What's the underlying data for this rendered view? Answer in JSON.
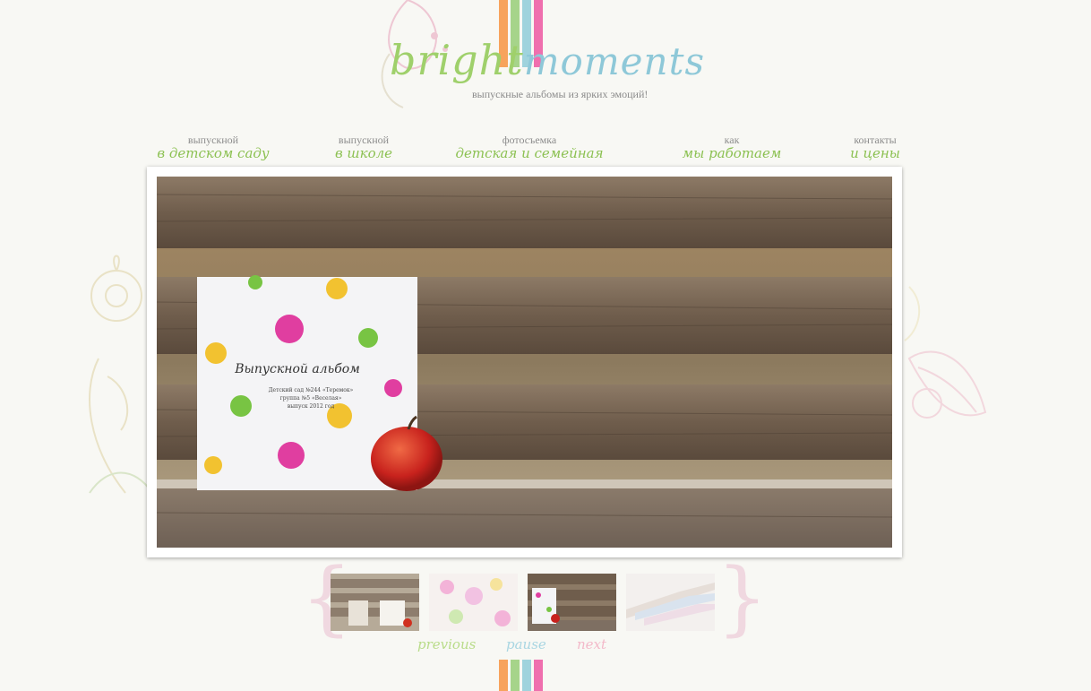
{
  "header": {
    "logo_bright": "bright",
    "logo_moments": "moments",
    "tagline": "выпускные альбомы из ярких эмоций!"
  },
  "nav": [
    {
      "top": "выпускной",
      "bottom": "в детском саду"
    },
    {
      "top": "выпускной",
      "bottom": "в школе"
    },
    {
      "top": "фотосъемка",
      "bottom": "детская и семейная"
    },
    {
      "top": "как",
      "bottom": "мы работаем"
    },
    {
      "top": "контакты",
      "bottom": "и цены"
    }
  ],
  "slide": {
    "album_title": "Выпускной альбом",
    "album_line1": "Детский сад №244 «Теремок»",
    "album_line2": "группа №5 «Веселая»",
    "album_line3": "выпуск 2012 год"
  },
  "controls": {
    "previous": "previous",
    "pause": "pause",
    "next": "next"
  },
  "colors": {
    "stripe_orange": "#f7a35c",
    "stripe_green": "#a6d48a",
    "stripe_blue": "#9fd3dd",
    "stripe_pink": "#ef6fae",
    "nav_green": "#8cc152",
    "prev_color": "#b9dc8a",
    "pause_color": "#a9d6e2",
    "next_color": "#f3b9c9"
  },
  "icons": [
    "flower-decoration",
    "flower-decoration-left",
    "flower-decoration-right"
  ]
}
